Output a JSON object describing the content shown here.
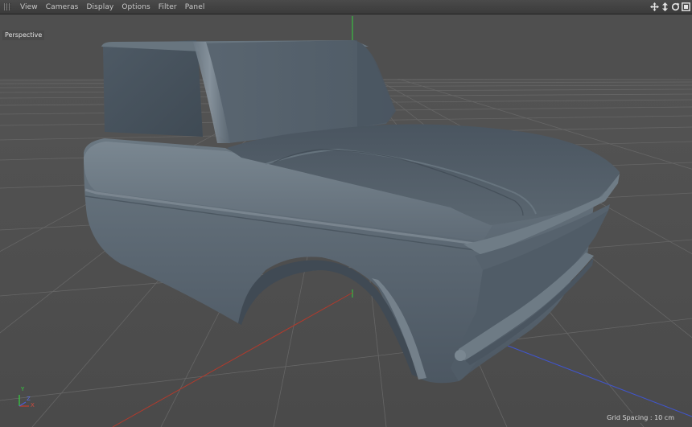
{
  "menu": {
    "items": [
      "View",
      "Cameras",
      "Display",
      "Options",
      "Filter",
      "Panel"
    ]
  },
  "nav_icons": [
    "move-view-icon",
    "dolly-icon",
    "rotate-view-icon",
    "toggle-panel-icon"
  ],
  "viewport": {
    "camera_label": "Perspective",
    "grid_spacing": "Grid Spacing : 10 cm",
    "axes": {
      "x": "X",
      "y": "Y",
      "z": "Z"
    }
  },
  "colors": {
    "background": "#4d4d4d",
    "grid_line": "#5e5e5e",
    "grid_major": "#6a6a6a",
    "model": "#5d6a76",
    "x_axis": "#b23a2c",
    "y_axis": "#2fcf3a",
    "z_axis": "#3b4fcf"
  }
}
